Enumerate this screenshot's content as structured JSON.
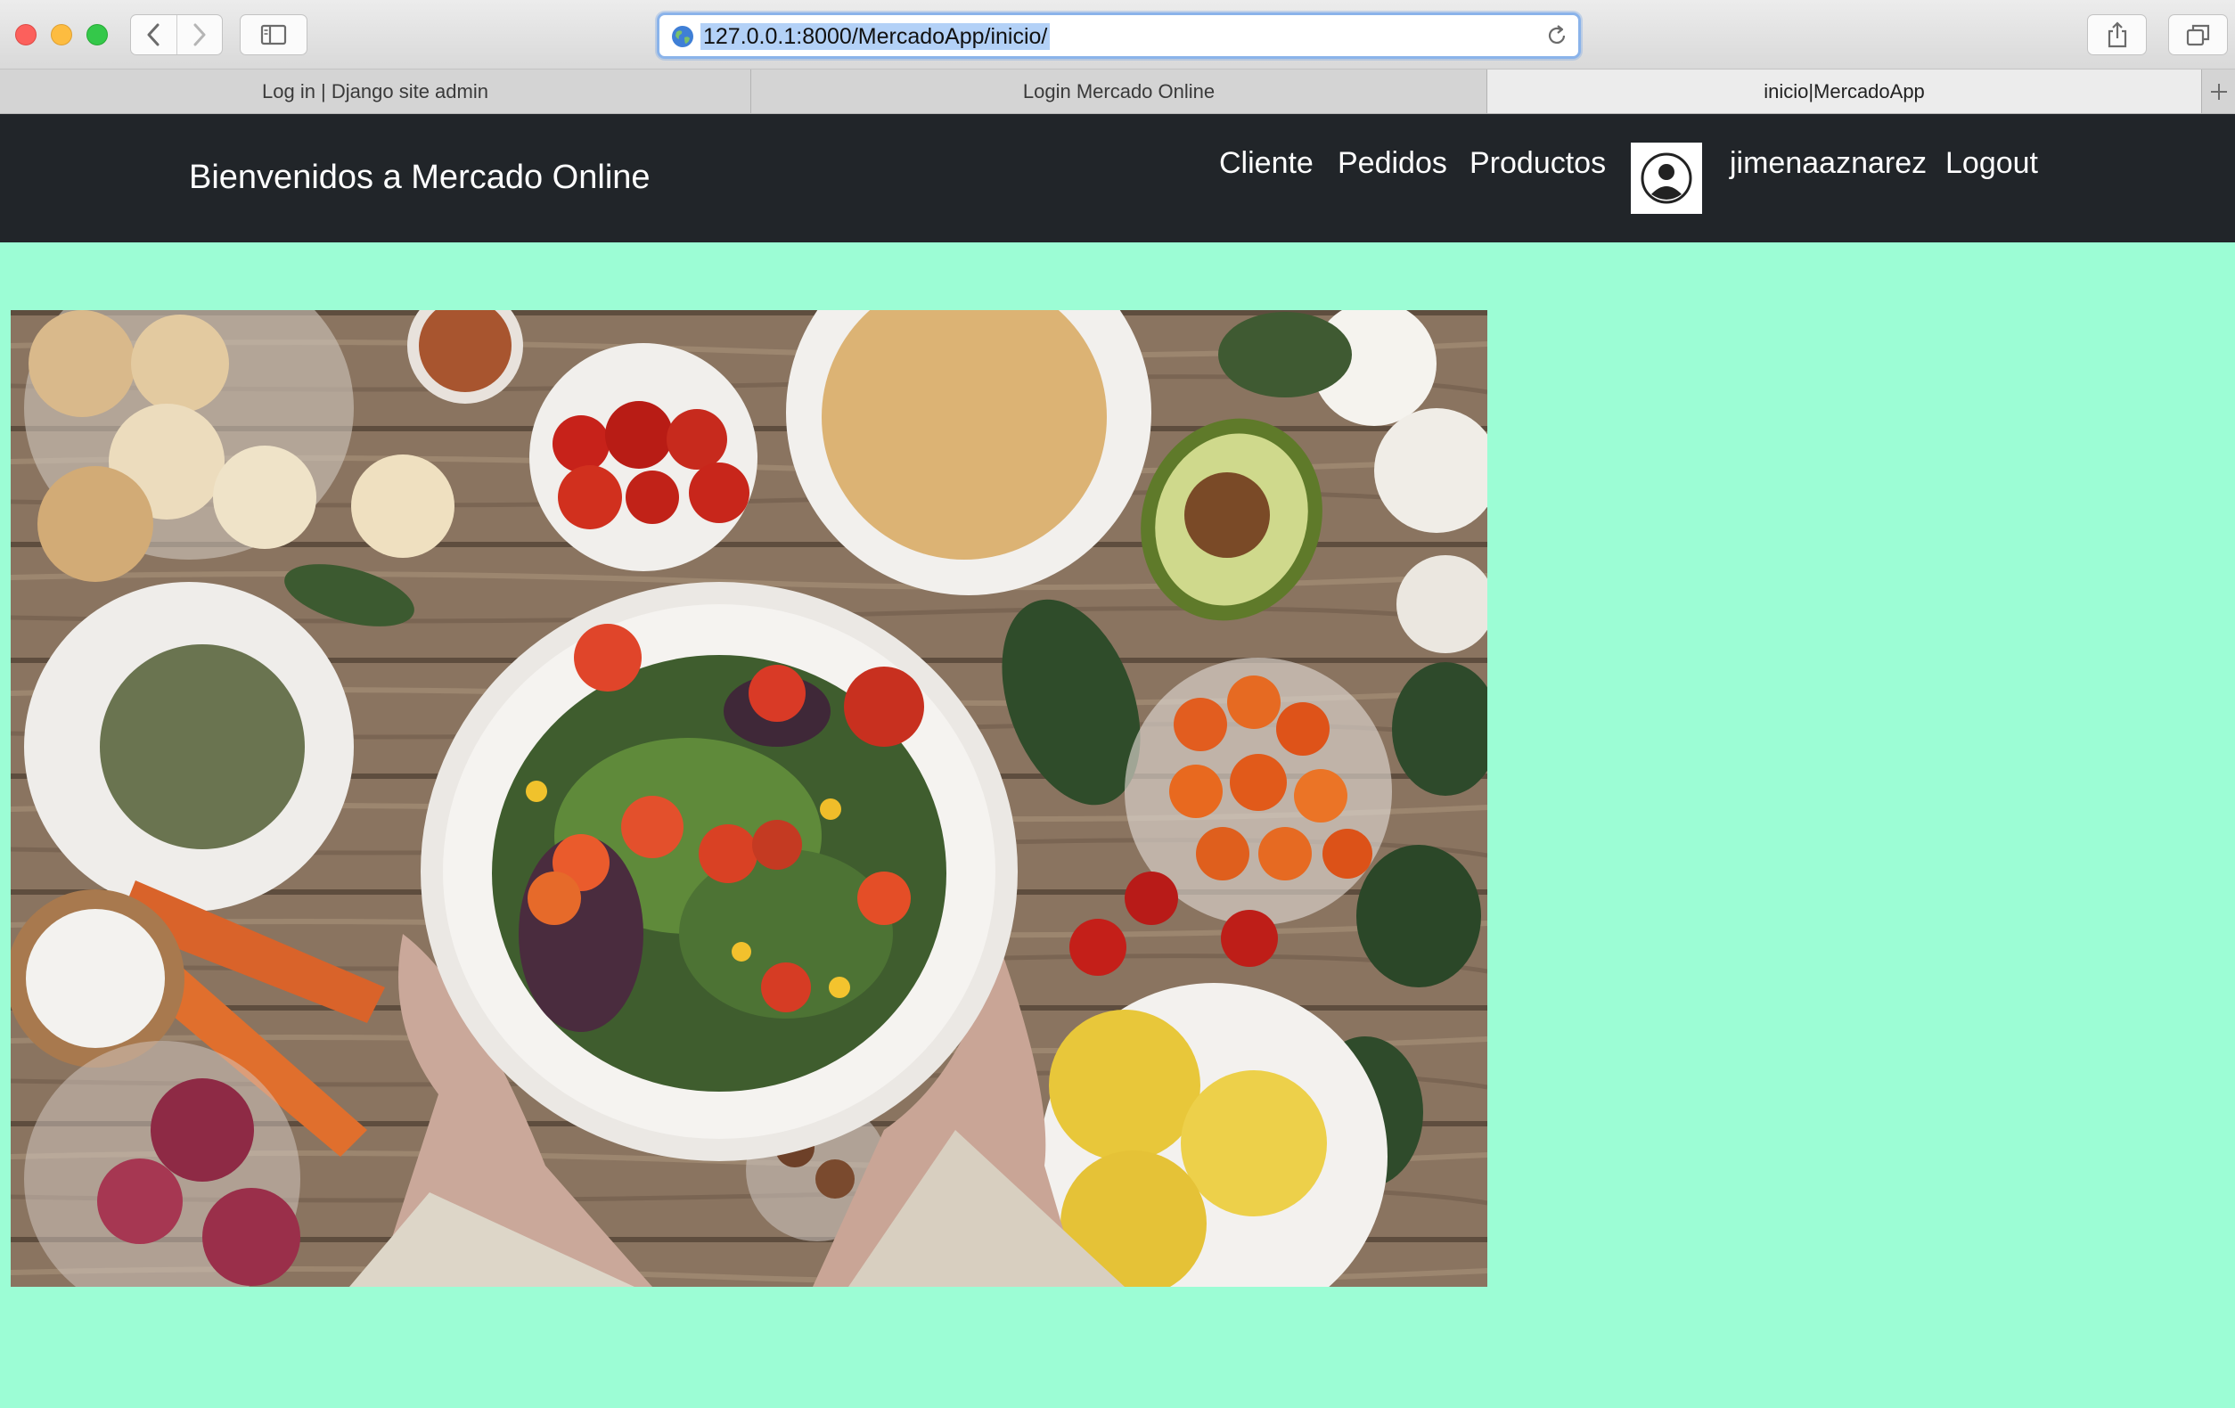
{
  "browser": {
    "url": "127.0.0.1:8000/MercadoApp/inicio/",
    "tabs": [
      {
        "label": "Log in | Django site admin"
      },
      {
        "label": "Login Mercado Online"
      },
      {
        "label": "inicio|MercadoApp"
      }
    ]
  },
  "navbar": {
    "brand": "Bienvenidos a Mercado Online",
    "links": {
      "cliente": "Cliente",
      "pedidos": "Pedidos",
      "productos": "Productos",
      "username": "jimenaaznarez",
      "logout": "Logout"
    },
    "background": "#212529"
  },
  "page": {
    "background": "#9cfdd5"
  },
  "icons": [
    "back-icon",
    "forward-icon",
    "sidebar-icon",
    "globe-icon",
    "reload-icon",
    "share-icon",
    "tabs-overview-icon",
    "new-tab-icon",
    "user-avatar-icon"
  ]
}
